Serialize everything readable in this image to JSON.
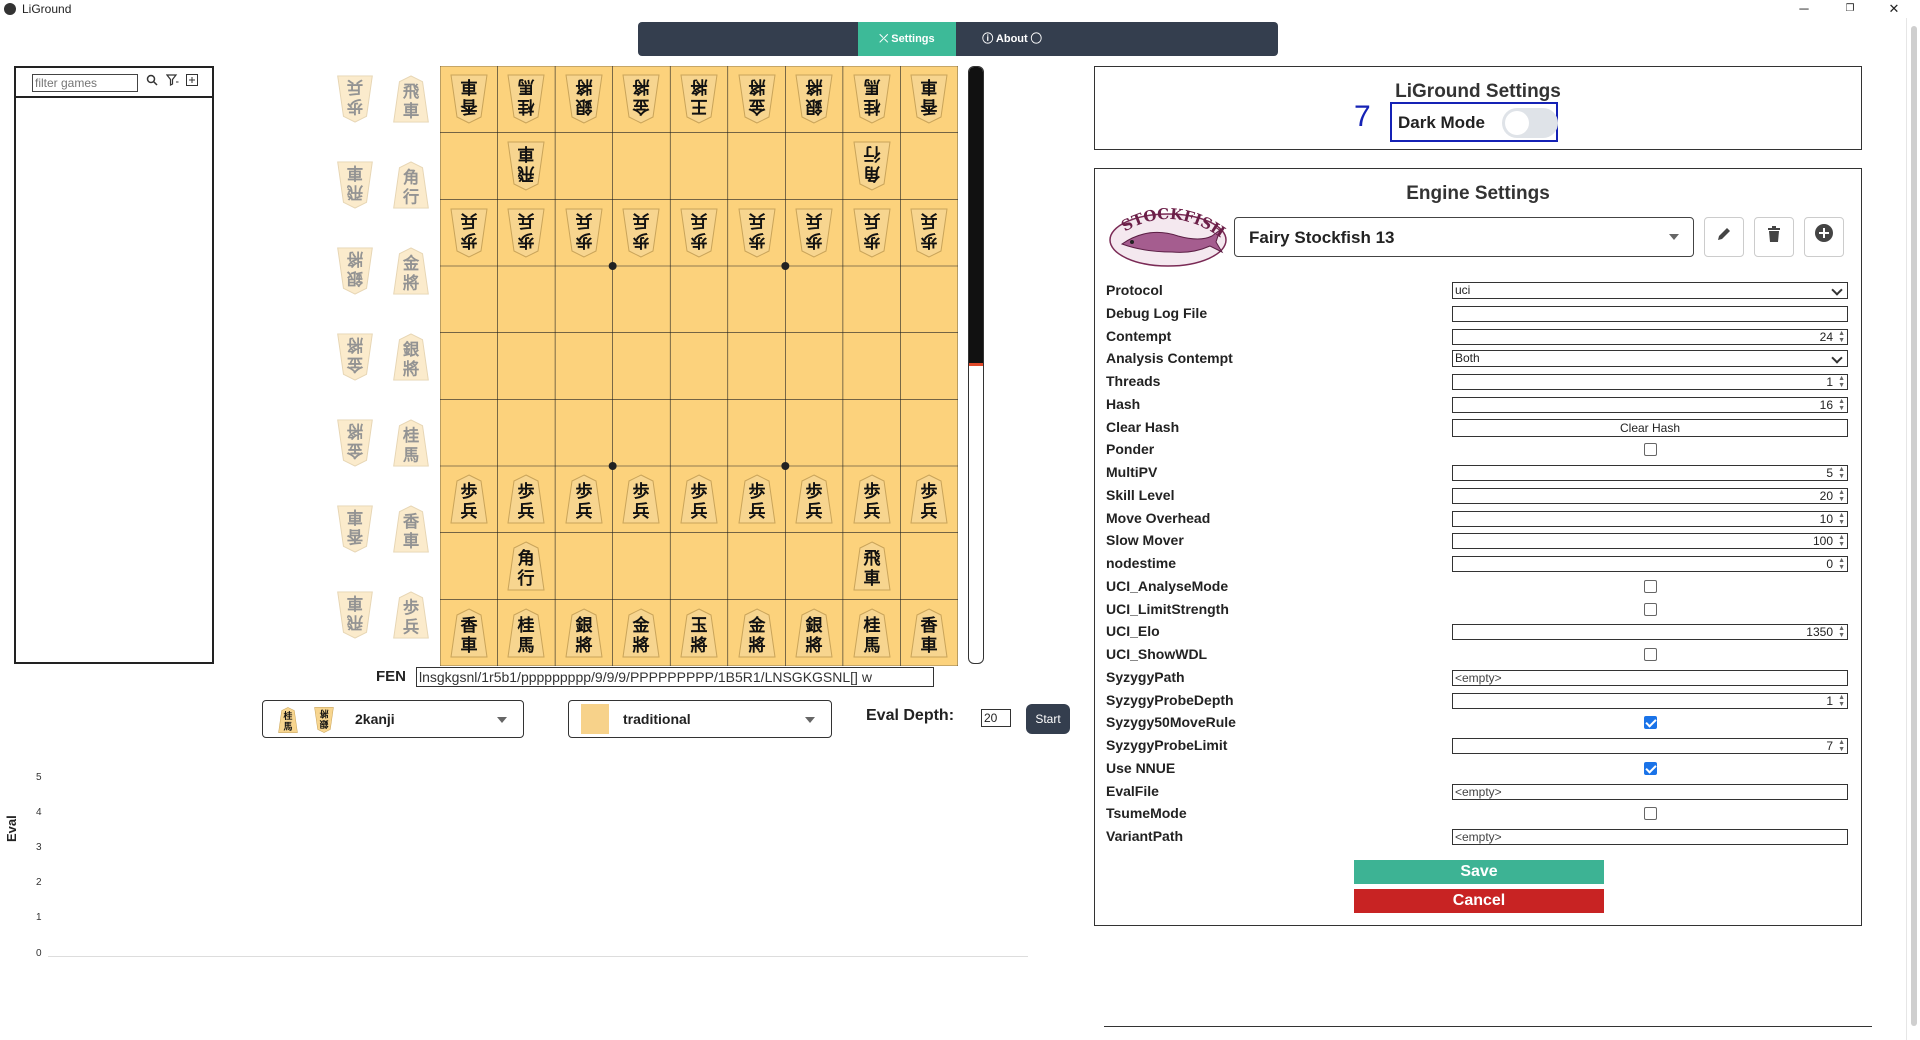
{
  "window": {
    "title": "LiGround",
    "minimize": "─",
    "restore": "❐",
    "close": "✕"
  },
  "navbar": {
    "settings_label": "⤫ Settings",
    "about_label": "ⓘ About ◯"
  },
  "game_list": {
    "filter_placeholder": "filter games"
  },
  "pieces": {
    "rook": [
      "飛",
      "車"
    ],
    "bishop": [
      "角",
      "行"
    ],
    "gold": [
      "金",
      "將"
    ],
    "silver": [
      "銀",
      "將"
    ],
    "knight": [
      "桂",
      "馬"
    ],
    "lance": [
      "香",
      "車"
    ],
    "pawn": [
      "歩",
      "兵"
    ],
    "king": [
      "王",
      "將"
    ],
    "jade": [
      "玉",
      "將"
    ]
  },
  "board": {
    "rows": [
      [
        "lance",
        "knight",
        "silver",
        "gold",
        "king",
        "gold",
        "silver",
        "knight",
        "lance"
      ],
      [
        null,
        "rook",
        null,
        null,
        null,
        null,
        null,
        "bishop",
        null
      ],
      [
        "pawn",
        "pawn",
        "pawn",
        "pawn",
        "pawn",
        "pawn",
        "pawn",
        "pawn",
        "pawn"
      ],
      [
        null,
        null,
        null,
        null,
        null,
        null,
        null,
        null,
        null
      ],
      [
        null,
        null,
        null,
        null,
        null,
        null,
        null,
        null,
        null
      ],
      [
        null,
        null,
        null,
        null,
        null,
        null,
        null,
        null,
        null
      ],
      [
        "pawn",
        "pawn",
        "pawn",
        "pawn",
        "pawn",
        "pawn",
        "pawn",
        "pawn",
        "pawn"
      ],
      [
        null,
        "bishop",
        null,
        null,
        null,
        null,
        null,
        "rook",
        null
      ],
      [
        "lance",
        "knight",
        "silver",
        "gold",
        "jade",
        "gold",
        "silver",
        "knight",
        "lance"
      ]
    ],
    "gote_rows": 3,
    "colors": {
      "board": "#fcd27c",
      "line": "#222222",
      "piece": "#f7d58f",
      "ink": "#111111"
    }
  },
  "hand_pieces": {
    "col_a": [
      "pawn",
      "rook",
      "silver",
      "gold",
      "gold",
      "lance",
      "rook"
    ],
    "col_b": [
      "rook",
      "bishop",
      "gold",
      "silver",
      "knight",
      "lance",
      "pawn"
    ]
  },
  "fen": {
    "label": "FEN",
    "value": "lnsgkgsnl/1r5b1/ppppppppp/9/9/9/PPPPPPPPP/1B5R1/LNSGKGSNL[] w"
  },
  "piece_style": {
    "label": "2kanji",
    "mini_pieces": [
      "knight",
      "silver"
    ]
  },
  "board_style": {
    "label": "traditional"
  },
  "eval_depth": {
    "label": "Eval Depth:",
    "value": "20"
  },
  "start_button": "Start",
  "eval_bar": {
    "black_fraction": 0.5
  },
  "eval_chart": {
    "ylabel": "Eval",
    "yticks": [
      "5",
      "4",
      "3",
      "2",
      "1",
      "0"
    ]
  },
  "liground_settings": {
    "title": "LiGround Settings",
    "dark_mode_label": "Dark Mode",
    "dark_mode_on": false,
    "annotation_number": "7"
  },
  "engine_settings": {
    "title": "Engine Settings",
    "logo_text": "STOCKFISH",
    "engine_name": "Fairy Stockfish 13",
    "edit_icon": "✎",
    "delete_icon": "🗑",
    "add_icon": "+",
    "options": [
      {
        "label": "Protocol",
        "type": "select",
        "value": "uci"
      },
      {
        "label": "Debug Log File",
        "type": "text",
        "value": ""
      },
      {
        "label": "Contempt",
        "type": "number",
        "value": "24"
      },
      {
        "label": "Analysis Contempt",
        "type": "select",
        "value": "Both"
      },
      {
        "label": "Threads",
        "type": "number",
        "value": "1"
      },
      {
        "label": "Hash",
        "type": "number",
        "value": "16"
      },
      {
        "label": "Clear Hash",
        "type": "button",
        "value": "Clear Hash"
      },
      {
        "label": "Ponder",
        "type": "check",
        "value": false
      },
      {
        "label": "MultiPV",
        "type": "number",
        "value": "5"
      },
      {
        "label": "Skill Level",
        "type": "number",
        "value": "20"
      },
      {
        "label": "Move Overhead",
        "type": "number",
        "value": "10"
      },
      {
        "label": "Slow Mover",
        "type": "number",
        "value": "100"
      },
      {
        "label": "nodestime",
        "type": "number",
        "value": "0"
      },
      {
        "label": "UCI_AnalyseMode",
        "type": "check",
        "value": false
      },
      {
        "label": "UCI_LimitStrength",
        "type": "check",
        "value": false
      },
      {
        "label": "UCI_Elo",
        "type": "number",
        "value": "1350"
      },
      {
        "label": "UCI_ShowWDL",
        "type": "check",
        "value": false
      },
      {
        "label": "SyzygyPath",
        "type": "text",
        "value": "<empty>"
      },
      {
        "label": "SyzygyProbeDepth",
        "type": "number",
        "value": "1"
      },
      {
        "label": "Syzygy50MoveRule",
        "type": "check",
        "value": true
      },
      {
        "label": "SyzygyProbeLimit",
        "type": "number",
        "value": "7"
      },
      {
        "label": "Use NNUE",
        "type": "check",
        "value": true
      },
      {
        "label": "EvalFile",
        "type": "text",
        "value": "<empty>"
      },
      {
        "label": "TsumeMode",
        "type": "check",
        "value": false
      },
      {
        "label": "VariantPath",
        "type": "text",
        "value": "<empty>"
      }
    ],
    "save_label": "Save",
    "cancel_label": "Cancel"
  }
}
